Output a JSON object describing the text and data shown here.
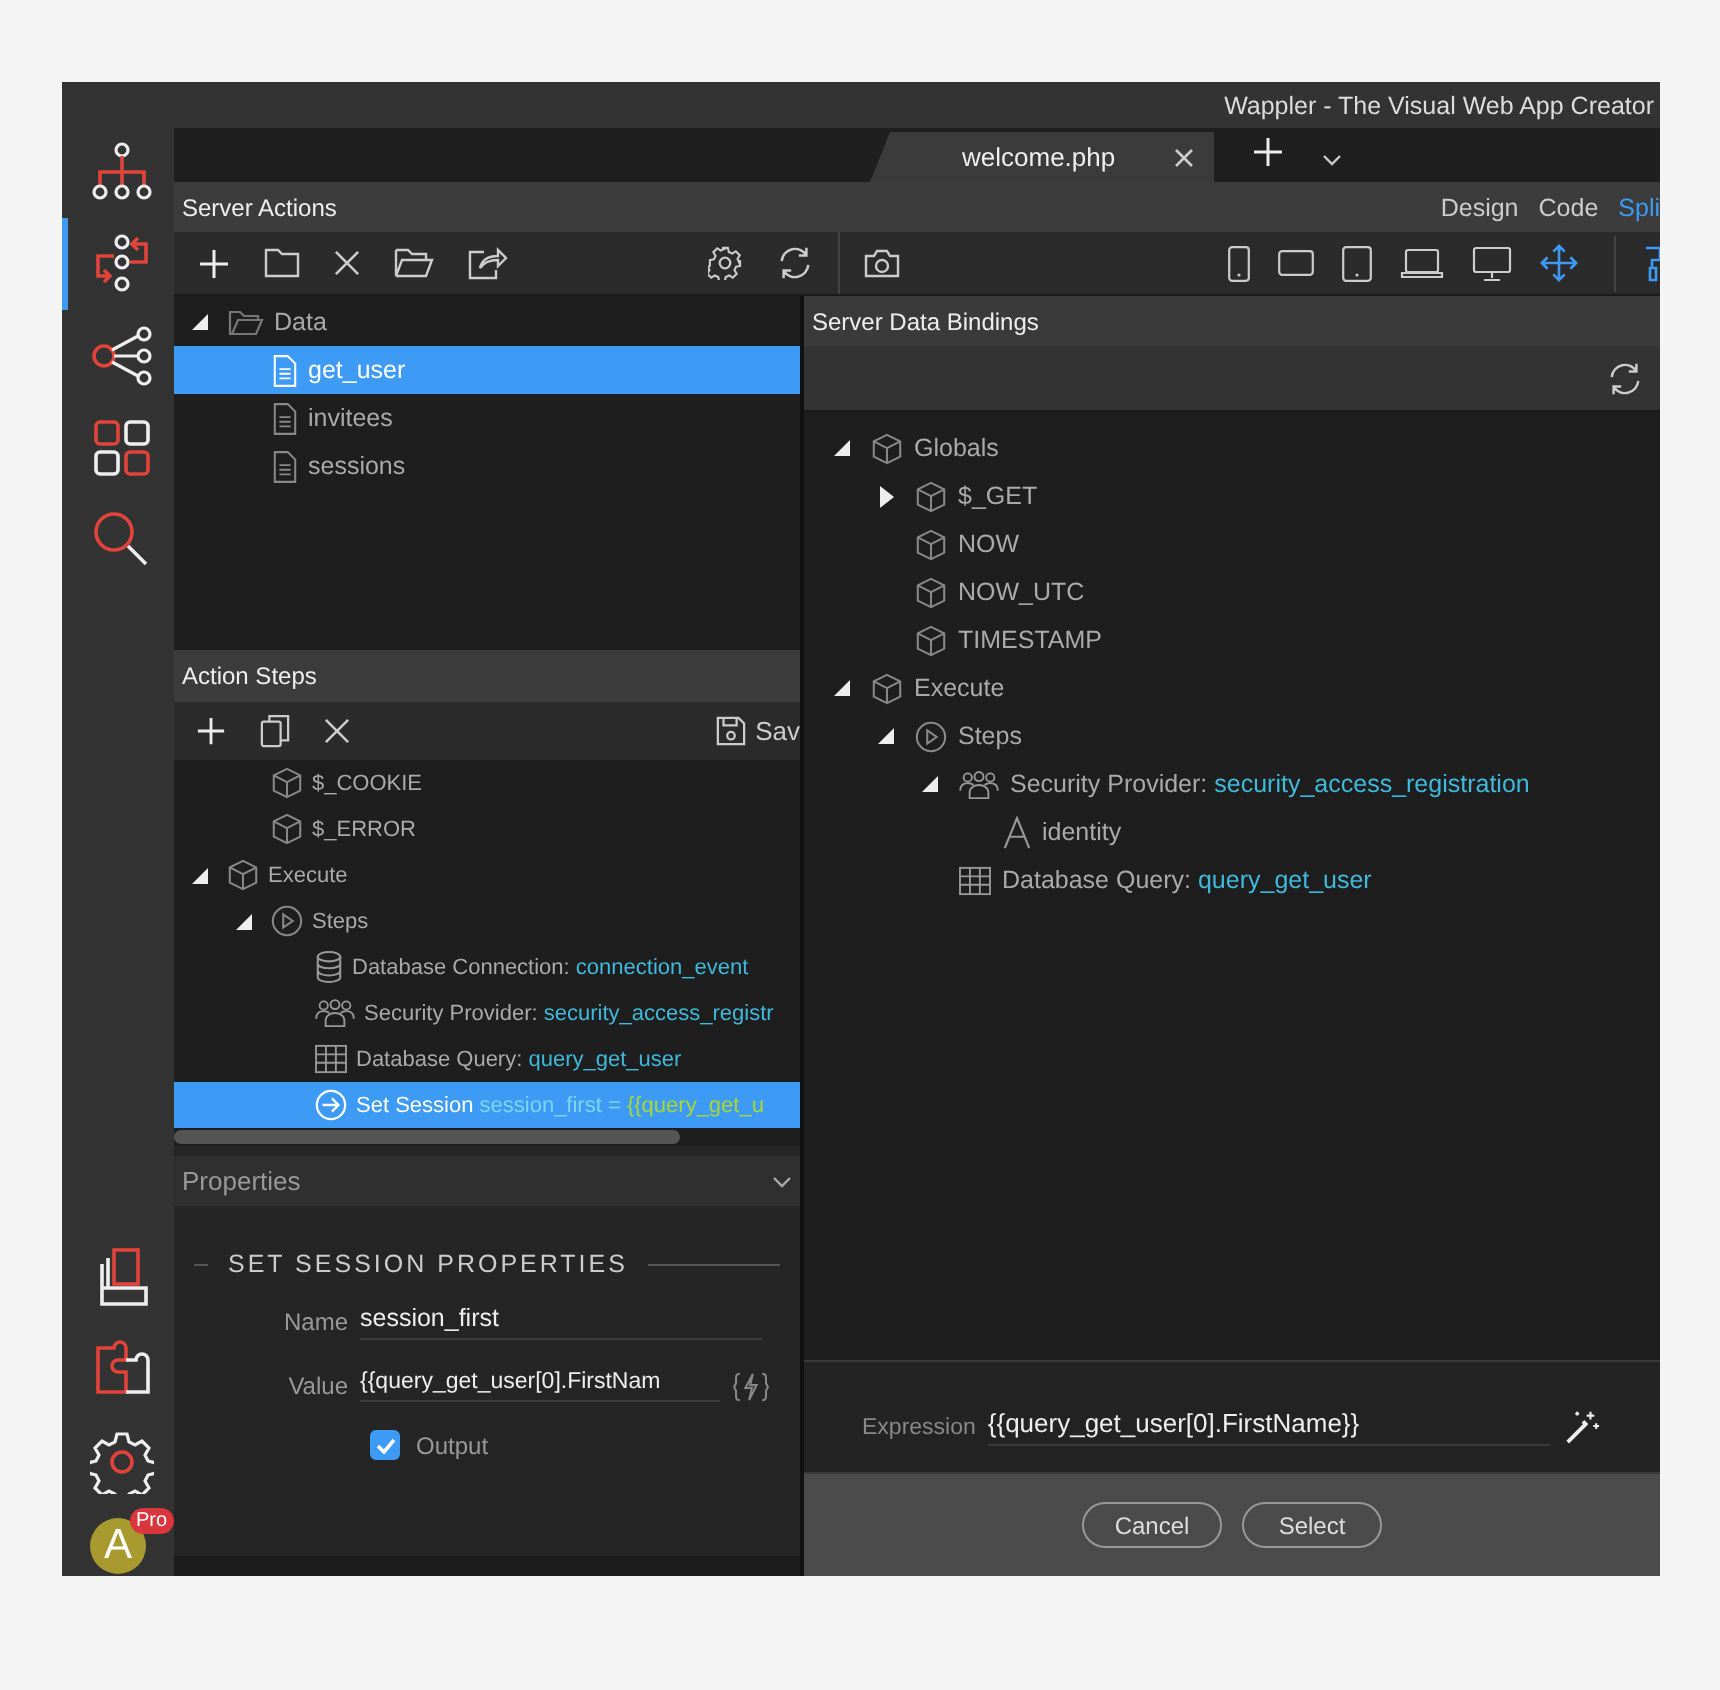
{
  "window": {
    "title": "Wappler - The Visual Web App Creator"
  },
  "sidebar": {
    "items": [
      {
        "kind": "hierarchy",
        "selected": false
      },
      {
        "kind": "flow",
        "selected": true
      },
      {
        "kind": "share",
        "selected": false
      },
      {
        "kind": "grid",
        "selected": false
      },
      {
        "kind": "search",
        "selected": false
      }
    ],
    "avatar": {
      "initial": "A",
      "badge": "Pro"
    }
  },
  "tabs": [
    {
      "label": "welcome.php",
      "selected": true
    }
  ],
  "panel": {
    "title": "Server Actions",
    "views": [
      {
        "label": "Design",
        "selected": false
      },
      {
        "label": "Code",
        "selected": false
      },
      {
        "label": "Spli",
        "selected": true
      }
    ]
  },
  "server_actions": {
    "tree": [
      {
        "label": "Data",
        "kind": "folder",
        "expanded": true,
        "selected": false,
        "children": [
          {
            "label": "get_user",
            "kind": "file",
            "selected": true
          },
          {
            "label": "invitees",
            "kind": "file",
            "selected": false
          },
          {
            "label": "sessions",
            "kind": "file",
            "selected": false
          }
        ]
      }
    ]
  },
  "action_steps": {
    "title": "Action Steps",
    "save_label": "Sav",
    "continued_items": [
      {
        "label": "$_COOKIE",
        "kind": "cube",
        "selected": false
      },
      {
        "label": "$_ERROR",
        "kind": "cube",
        "selected": false
      }
    ],
    "tree": [
      {
        "label": "Execute",
        "kind": "cube",
        "expanded": true,
        "selected": false,
        "children": [
          {
            "label": "Steps",
            "kind": "play",
            "expanded": true,
            "selected": false,
            "children": [
              {
                "label": "Database Connection:",
                "target": "connection_event",
                "kind": "database",
                "selected": false
              },
              {
                "label": "Security Provider:",
                "target": "security_access_registr",
                "kind": "users",
                "selected": false
              },
              {
                "label": "Database Query:",
                "target": "query_get_user",
                "kind": "table",
                "selected": false
              },
              {
                "label": "Set Session",
                "target": "session_first =",
                "expression": "{{query_get_u",
                "kind": "arrow",
                "selected": true
              }
            ]
          }
        ]
      }
    ]
  },
  "properties": {
    "title": "Properties",
    "section": "SET SESSION PROPERTIES",
    "fields": [
      {
        "label": "Name",
        "value": "session_first",
        "kind": "text"
      },
      {
        "label": "Value",
        "value": "{{query_get_user[0].FirstNam",
        "kind": "bindable"
      }
    ],
    "output": {
      "label": "Output",
      "checked": true
    }
  },
  "bindings_dialog": {
    "title": "Server Data Bindings",
    "tree": [
      {
        "label": "Globals",
        "kind": "cube",
        "expanded": true,
        "children": [
          {
            "label": "$_GET",
            "kind": "cube",
            "expanded": false
          },
          {
            "label": "NOW",
            "kind": "cube"
          },
          {
            "label": "NOW_UTC",
            "kind": "cube"
          },
          {
            "label": "TIMESTAMP",
            "kind": "cube"
          }
        ]
      },
      {
        "label": "Execute",
        "kind": "cube",
        "expanded": true,
        "children": [
          {
            "label": "Steps",
            "kind": "play",
            "expanded": true,
            "children": [
              {
                "label": "Security Provider:",
                "target": "security_access_registration",
                "kind": "users",
                "expanded": true,
                "children": [
                  {
                    "label": "identity",
                    "kind": "letter"
                  }
                ]
              },
              {
                "label": "Database Query:",
                "target": "query_get_user",
                "kind": "table"
              }
            ]
          }
        ]
      }
    ],
    "expression": {
      "label": "Expression",
      "value": "{{query_get_user[0].FirstName}}"
    },
    "buttons": [
      "Cancel",
      "Select"
    ]
  }
}
